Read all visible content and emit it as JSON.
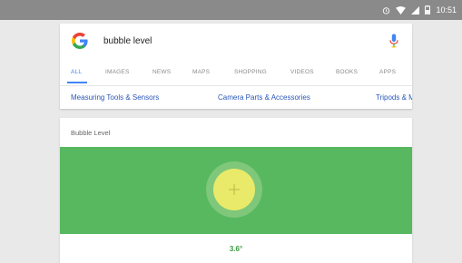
{
  "status_bar": {
    "time": "10:51",
    "icons": [
      "alarm-icon",
      "wifi-icon",
      "signal-icon",
      "battery-icon"
    ]
  },
  "search": {
    "query": "bubble level",
    "logo": "google-g-logo",
    "mic_icon": "mic-icon"
  },
  "tabs": [
    {
      "label": "ALL",
      "active": true
    },
    {
      "label": "IMAGES"
    },
    {
      "label": "NEWS"
    },
    {
      "label": "MAPS"
    },
    {
      "label": "SHOPPING"
    },
    {
      "label": "VIDEOS"
    },
    {
      "label": "BOOKS"
    },
    {
      "label": "APPS"
    }
  ],
  "chips": [
    "Measuring Tools & Sensors",
    "Camera Parts & Accessories",
    "Tripods & Mo"
  ],
  "level": {
    "title": "Bubble Level",
    "reading": "3.6°"
  },
  "colors": {
    "accent": "#4285f4",
    "level_green": "#57b85f",
    "bubble": "#eaea6a",
    "reading_green": "#3a9a3f"
  }
}
